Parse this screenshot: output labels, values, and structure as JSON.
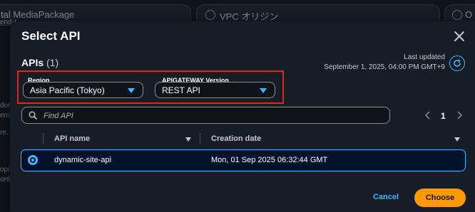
{
  "background": {
    "card1_text": "tal MediaPackage",
    "card2_text": "VPC オリジン",
    "card3_text": "O",
    "side_fragments": [
      "end-t",
      "dori",
      "eme",
      "re.",
      "opi",
      "orth"
    ]
  },
  "modal": {
    "title": "Select API",
    "apis_label": "APIs",
    "apis_count": "(1)",
    "last_updated_label": "Last updated",
    "last_updated_value": "September 1, 2025, 04:00 PM GMT+9",
    "region": {
      "label": "Region",
      "value": "Asia Pacific (Tokyo)"
    },
    "version": {
      "label": "APIGATEWAY Version",
      "value": "REST API"
    },
    "search": {
      "placeholder": "Find API",
      "value": ""
    },
    "pagination": {
      "current": "1"
    },
    "table": {
      "columns": [
        "API name",
        "Creation date"
      ],
      "rows": [
        {
          "name": "dynamic-site-api",
          "created": "Mon, 01 Sep 2025 06:32:44 GMT",
          "selected": true
        }
      ]
    },
    "actions": {
      "cancel": "Cancel",
      "choose": "Choose"
    }
  },
  "colors": {
    "accent": "#42b4ff",
    "primary_button": "#ff9900",
    "highlight_box": "#e0281e",
    "modal_bg": "#161d26"
  },
  "icons": [
    "close-icon",
    "refresh-icon",
    "search-icon",
    "chevron-left-icon",
    "chevron-right-icon",
    "caret-down-icon",
    "sort-caret-icon"
  ]
}
